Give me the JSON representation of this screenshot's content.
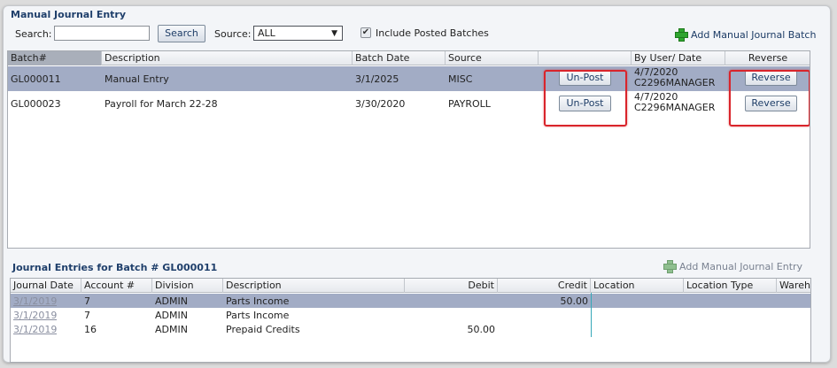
{
  "panel_title": "Manual Journal Entry",
  "search": {
    "label": "Search:",
    "value": "",
    "button": "Search"
  },
  "source": {
    "label": "Source:",
    "selected": "ALL"
  },
  "include_posted": {
    "label": "Include Posted Batches",
    "checked": true,
    "check_glyph": "✔"
  },
  "add_batch_label": "Add Manual Journal Batch",
  "batch_table": {
    "columns": [
      "Batch#",
      "Description",
      "Batch Date",
      "Source",
      "",
      "By User/ Date",
      "Reverse"
    ],
    "rows": [
      {
        "batch": "GL000011",
        "description": "Manual Entry",
        "date": "3/1/2025",
        "source": "MISC",
        "action": "Un-Post",
        "user_date": "4/7/2020",
        "user": "C2296MANAGER",
        "reverse": "Reverse"
      },
      {
        "batch": "GL000023",
        "description": "Payroll for March 22-28",
        "date": "3/30/2020",
        "source": "PAYROLL",
        "action": "Un-Post",
        "user_date": "4/7/2020",
        "user": "C2296MANAGER",
        "reverse": "Reverse"
      }
    ]
  },
  "entries_title": "Journal Entries for Batch # GL000011",
  "add_entry_label": "Add Manual Journal Entry",
  "entries_table": {
    "columns": [
      "Journal Date",
      "Account #",
      "Division",
      "Description",
      "Debit",
      "Credit",
      "Location",
      "Location Type",
      "Wareho"
    ],
    "rows": [
      {
        "date": "3/1/2019",
        "account": "7",
        "division": "ADMIN",
        "description": "Parts Income",
        "debit": "",
        "credit": "50.00"
      },
      {
        "date": "3/1/2019",
        "account": "7",
        "division": "ADMIN",
        "description": "Parts Income",
        "debit": "",
        "credit": ""
      },
      {
        "date": "3/1/2019",
        "account": "16",
        "division": "ADMIN",
        "description": "Prepaid Credits",
        "debit": "50.00",
        "credit": ""
      }
    ]
  },
  "colors": {
    "selected_row": "#a2acc5",
    "highlight_box": "#d9242b",
    "title": "#1f3f6b"
  }
}
